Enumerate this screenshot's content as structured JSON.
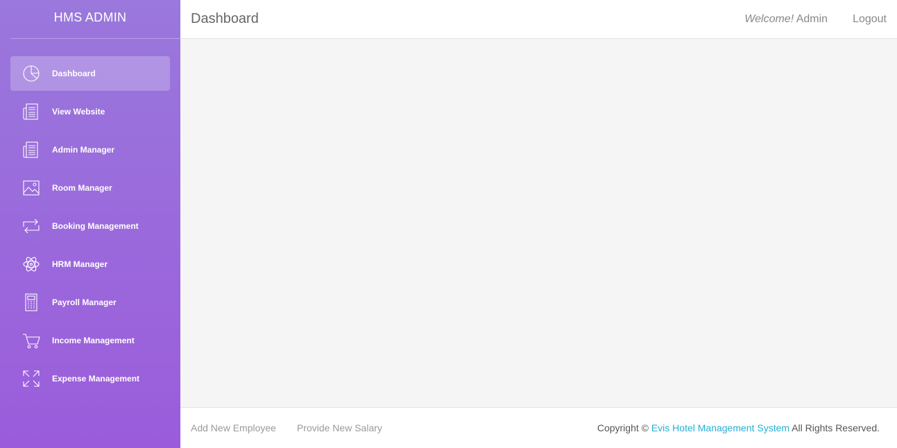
{
  "sidebar": {
    "brand": "HMS ADMIN",
    "items": [
      {
        "label": "Dashboard",
        "icon": "pie-chart-icon",
        "active": true
      },
      {
        "label": "View Website",
        "icon": "news-icon"
      },
      {
        "label": "Admin Manager",
        "icon": "news-icon"
      },
      {
        "label": "Room Manager",
        "icon": "image-icon"
      },
      {
        "label": "Booking Management",
        "icon": "repeat-arrows-icon"
      },
      {
        "label": "HRM Manager",
        "icon": "atom-icon"
      },
      {
        "label": "Payroll Manager",
        "icon": "calculator-icon"
      },
      {
        "label": "Income Management",
        "icon": "cart-icon"
      },
      {
        "label": "Expense Management",
        "icon": "expand-icon"
      }
    ]
  },
  "header": {
    "title": "Dashboard",
    "welcome_prefix": "Welcome!",
    "welcome_user": "Admin",
    "logout_label": "Logout"
  },
  "footer": {
    "links": [
      "Add New Employee",
      "Provide New Salary"
    ],
    "copyright_prefix": "Copyright ©",
    "company": "Evis Hotel Management System",
    "copyright_suffix": "All Rights Reserved."
  },
  "colors": {
    "sidebar_top": "#9a78dc",
    "sidebar_bottom": "#9b5cdb",
    "link_accent": "#23b1d6"
  }
}
